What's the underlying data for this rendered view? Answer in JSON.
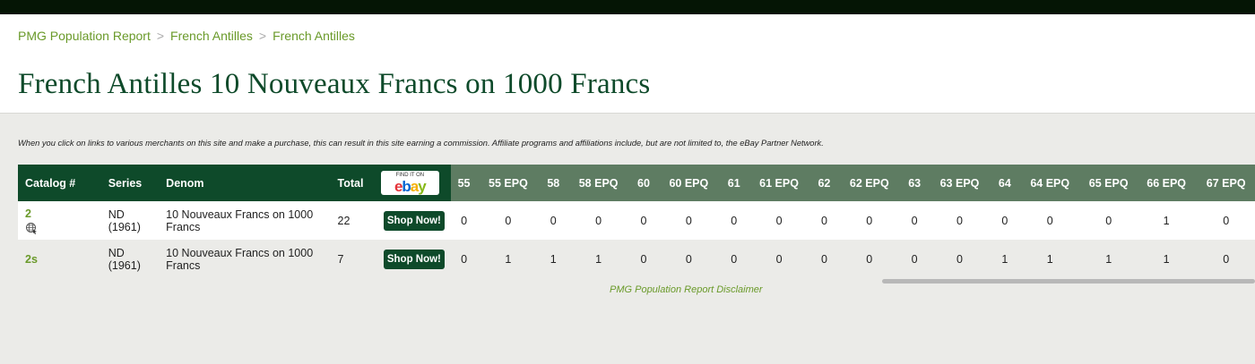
{
  "breadcrumb": [
    {
      "label": "PMG Population Report"
    },
    {
      "label": "French Antilles"
    },
    {
      "label": "French Antilles"
    }
  ],
  "breadcrumb_separator": ">",
  "page_title": "French Antilles 10 Nouveaux Francs on 1000 Francs",
  "disclosure": "When you click on links to various merchants on this site and make a purchase, this can result in this site earning a commission. Affiliate programs and affiliations include, but are not limited to, the eBay Partner Network.",
  "table": {
    "headers": {
      "catalog": "Catalog #",
      "series": "Series",
      "denom": "Denom",
      "total": "Total",
      "ebay_small": "FIND IT ON",
      "ebay_logo": [
        "e",
        "b",
        "a",
        "y"
      ],
      "grades": [
        "55",
        "55 EPQ",
        "58",
        "58 EPQ",
        "60",
        "60 EPQ",
        "61",
        "61 EPQ",
        "62",
        "62 EPQ",
        "63",
        "63 EPQ",
        "64",
        "64 EPQ",
        "65 EPQ",
        "66 EPQ",
        "67 EPQ"
      ]
    },
    "rows": [
      {
        "catalog": "2",
        "series_line1": "ND",
        "series_line2": "(1961)",
        "denom": "10 Nouveaux Francs on 1000 Francs",
        "total": "22",
        "shop_label": "Shop Now!",
        "grades": [
          "0",
          "0",
          "0",
          "0",
          "0",
          "0",
          "0",
          "0",
          "0",
          "0",
          "0",
          "0",
          "0",
          "0",
          "0",
          "1",
          "0"
        ]
      },
      {
        "catalog": "2s",
        "series_line1": "ND",
        "series_line2": "(1961)",
        "denom": "10 Nouveaux Francs on 1000 Francs",
        "total": "7",
        "shop_label": "Shop Now!",
        "grades": [
          "0",
          "1",
          "1",
          "1",
          "0",
          "0",
          "0",
          "0",
          "0",
          "0",
          "0",
          "0",
          "1",
          "1",
          "1",
          "1",
          "0"
        ]
      }
    ]
  },
  "disclaimer": "PMG Population Report Disclaimer",
  "colors": {
    "header_dark_green": "#0e4a2a",
    "grade_header_green": "#5e7c62",
    "link_green": "#6a9a2a",
    "ebay_e": "#e53238",
    "ebay_b": "#0064d2",
    "ebay_a": "#f5af02",
    "ebay_y": "#86b817"
  },
  "icons": {
    "globe": "globe-icon"
  }
}
